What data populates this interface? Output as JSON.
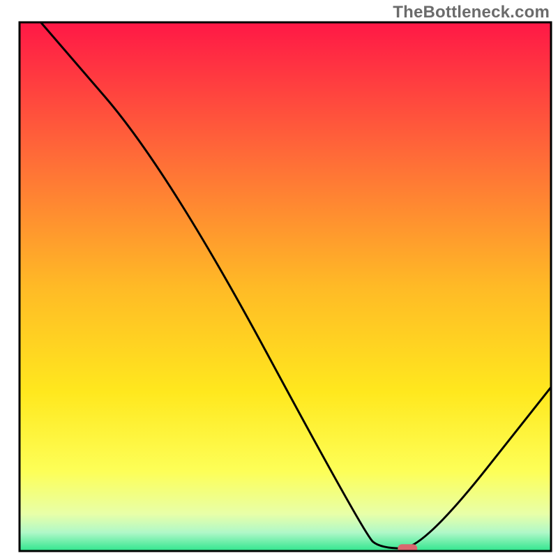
{
  "watermark": "TheBottleneck.com",
  "chart_data": {
    "type": "line",
    "title": "",
    "xlabel": "",
    "ylabel": "",
    "xlim": [
      0,
      100
    ],
    "ylim": [
      0,
      100
    ],
    "grid": false,
    "legend": null,
    "background_gradient_stops": [
      {
        "offset": 0.0,
        "color": "#ff1846"
      },
      {
        "offset": 0.25,
        "color": "#ff6a38"
      },
      {
        "offset": 0.5,
        "color": "#ffba26"
      },
      {
        "offset": 0.7,
        "color": "#ffe81e"
      },
      {
        "offset": 0.85,
        "color": "#fdff58"
      },
      {
        "offset": 0.93,
        "color": "#e8ffa8"
      },
      {
        "offset": 0.965,
        "color": "#b0f8c8"
      },
      {
        "offset": 1.0,
        "color": "#2fe58d"
      }
    ],
    "series": [
      {
        "name": "bottleneck-curve",
        "color": "#000000",
        "points": [
          {
            "x": 4,
            "y": 100
          },
          {
            "x": 28,
            "y": 72
          },
          {
            "x": 65,
            "y": 3
          },
          {
            "x": 68,
            "y": 0.5
          },
          {
            "x": 76,
            "y": 0.5
          },
          {
            "x": 100,
            "y": 31
          }
        ]
      }
    ],
    "marker": {
      "name": "optimal-marker",
      "x": 73,
      "y": 0.5,
      "color": "#d9676f",
      "rx": 14,
      "ry": 6
    },
    "frame": {
      "stroke": "#000000",
      "width": 3
    }
  }
}
